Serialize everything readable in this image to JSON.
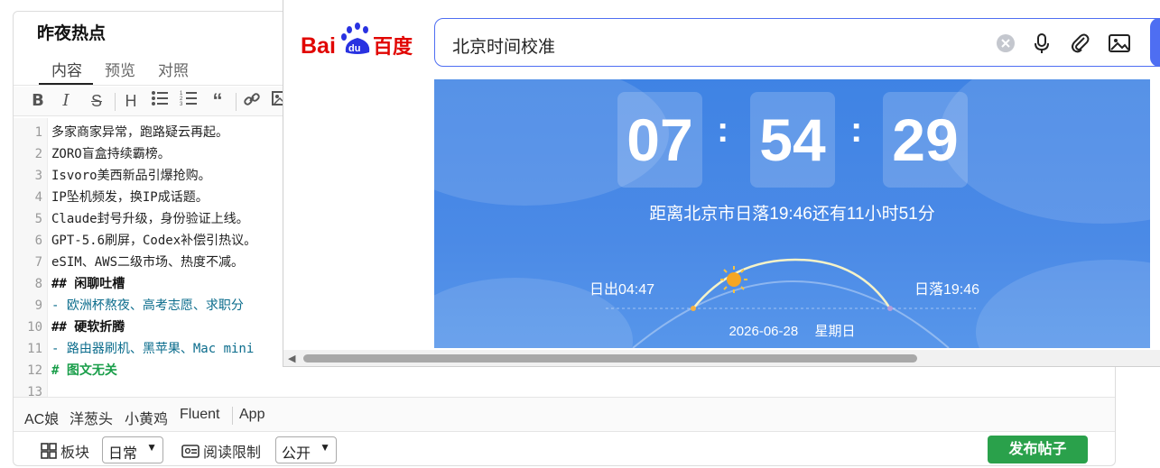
{
  "editor": {
    "title": "昨夜热点",
    "tabs": [
      "内容",
      "预览",
      "对照"
    ],
    "toolbar": [
      "bold-icon",
      "italic-icon",
      "strikethrough-icon",
      "heading-icon",
      "bullet-list-icon",
      "numbered-list-icon",
      "quote-icon",
      "link-icon",
      "image-icon"
    ],
    "lines": [
      {
        "n": "1",
        "text": "多家商家异常，跑路疑云再起。",
        "kind": "normal"
      },
      {
        "n": "2",
        "text": "ZORO盲盒持续霸榜。",
        "kind": "normal"
      },
      {
        "n": "3",
        "text": "Isvoro美西新品引爆抢购。",
        "kind": "normal"
      },
      {
        "n": "4",
        "text": "IP坠机频发，换IP成话题。",
        "kind": "normal"
      },
      {
        "n": "5",
        "text": "Claude封号升级，身份验证上线。",
        "kind": "normal"
      },
      {
        "n": "6",
        "text": "GPT-5.6刷屏，Codex补偿引热议。",
        "kind": "normal"
      },
      {
        "n": "7",
        "text": "eSIM、AWS二级市场、热度不减。",
        "kind": "normal"
      },
      {
        "n": "8",
        "text": "## 闲聊吐槽",
        "kind": "head"
      },
      {
        "n": "9",
        "text": "- 欧洲杯熬夜、高考志愿、求职分",
        "kind": "list"
      },
      {
        "n": "10",
        "text": "## 硬软折腾",
        "kind": "head"
      },
      {
        "n": "11",
        "text": "- 路由器刷机、黑苹果、Mac mini",
        "kind": "list"
      },
      {
        "n": "12",
        "text": "# 图文无关",
        "kind": "h1"
      },
      {
        "n": "13",
        "text": "",
        "kind": "normal"
      }
    ],
    "emoji_sets": [
      "AC娘",
      "洋葱头",
      "小黄鸡",
      "Fluent",
      "App"
    ],
    "bottom": {
      "board_label": "板块",
      "board_value": "日常",
      "read_limit_label": "阅读限制",
      "visibility_value": "公开",
      "publish_label": "发布帖子"
    }
  },
  "browser": {
    "logo_text": "Bai百度",
    "search": {
      "query": "北京时间校准",
      "icons": [
        "clear-icon",
        "microphone-icon",
        "attachment-icon",
        "image-search-icon"
      ]
    },
    "clock": {
      "hours": "07",
      "minutes": "54",
      "seconds": "29",
      "sunset_text": "距离北京市日落19:46还有11小时51分",
      "sunrise_label": "日出04:47",
      "sunset_label": "日落19:46",
      "date": "2026-06-28",
      "weekday": "星期日"
    }
  },
  "colors": {
    "publish": "#2aa14b",
    "search_border": "#4e6ef2",
    "widget_blue": "#3f83e4"
  }
}
